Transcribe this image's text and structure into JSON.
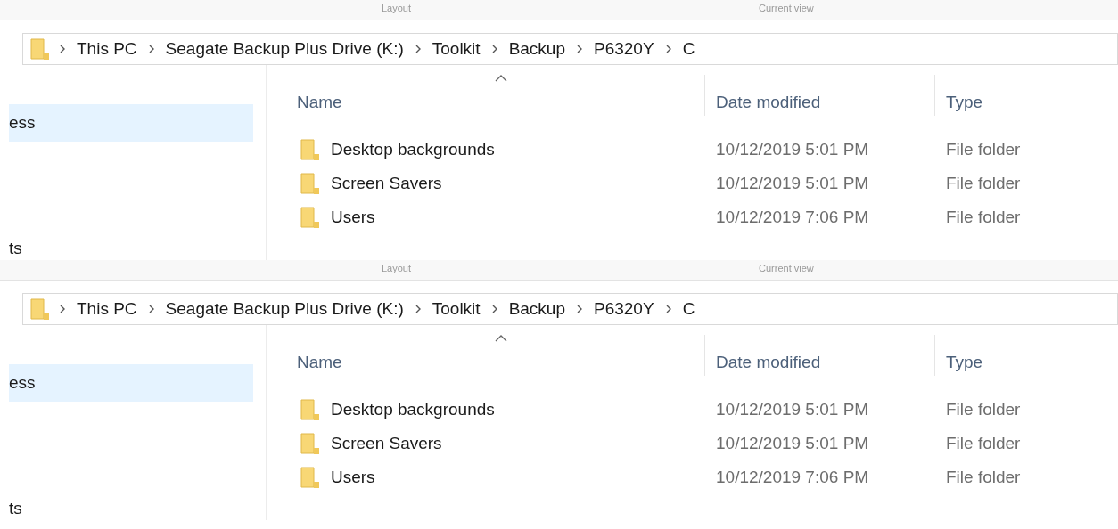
{
  "panels": [
    {
      "ribbon_groups": [
        "Layout",
        "Current view"
      ],
      "breadcrumb": [
        "This PC",
        "Seagate Backup Plus Drive (K:)",
        "Toolkit",
        "Backup",
        "P6320Y",
        "C"
      ],
      "sidebar": {
        "items": [
          {
            "label": "ess",
            "selected": true
          },
          {
            "label": "ts",
            "selected": false
          }
        ]
      },
      "table": {
        "columns": [
          {
            "label": "Name",
            "sorted": true
          },
          {
            "label": "Date modified",
            "sorted": false
          },
          {
            "label": "Type",
            "sorted": false
          }
        ],
        "rows": [
          {
            "name": "Desktop backgrounds",
            "date": "10/12/2019 5:01 PM",
            "type": "File folder"
          },
          {
            "name": "Screen Savers",
            "date": "10/12/2019 5:01 PM",
            "type": "File folder"
          },
          {
            "name": "Users",
            "date": "10/12/2019 7:06 PM",
            "type": "File folder"
          }
        ]
      }
    },
    {
      "ribbon_groups": [
        "Layout",
        "Current view"
      ],
      "breadcrumb": [
        "This PC",
        "Seagate Backup Plus Drive (K:)",
        "Toolkit",
        "Backup",
        "P6320Y",
        "C"
      ],
      "sidebar": {
        "items": [
          {
            "label": "ess",
            "selected": true
          },
          {
            "label": "ts",
            "selected": false
          }
        ]
      },
      "table": {
        "columns": [
          {
            "label": "Name",
            "sorted": true
          },
          {
            "label": "Date modified",
            "sorted": false
          },
          {
            "label": "Type",
            "sorted": false
          }
        ],
        "rows": [
          {
            "name": "Desktop backgrounds",
            "date": "10/12/2019 5:01 PM",
            "type": "File folder"
          },
          {
            "name": "Screen Savers",
            "date": "10/12/2019 5:01 PM",
            "type": "File folder"
          },
          {
            "name": "Users",
            "date": "10/12/2019 7:06 PM",
            "type": "File folder"
          }
        ]
      }
    }
  ]
}
